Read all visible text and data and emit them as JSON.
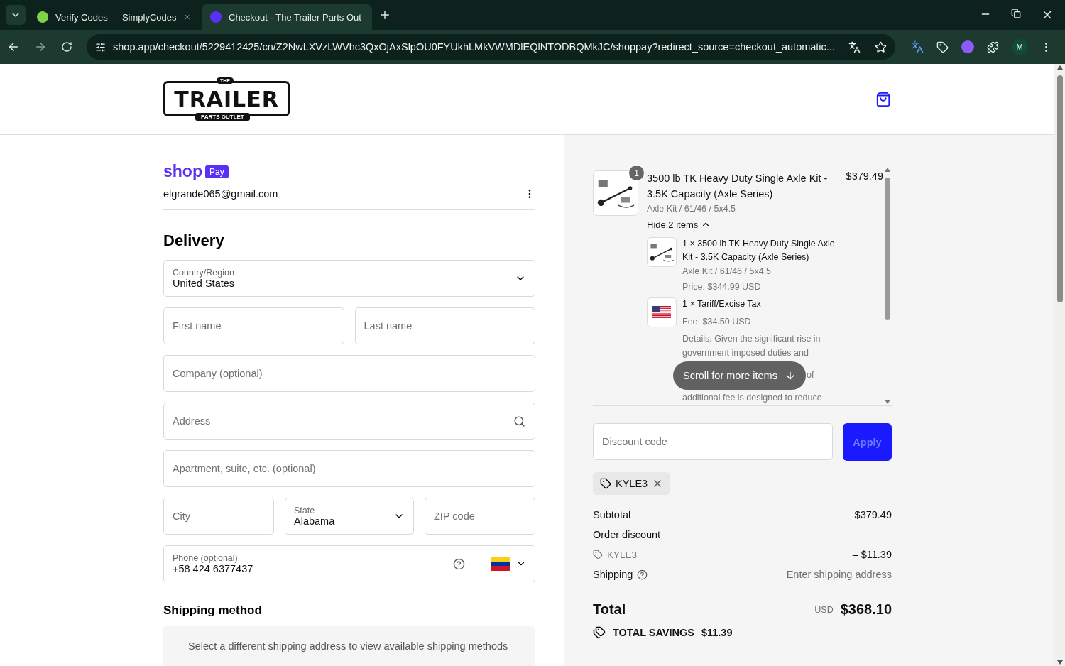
{
  "browser": {
    "tabs": [
      {
        "title": "Verify Codes — SimplyCodes",
        "selected": false
      },
      {
        "title": "Checkout - The Trailer Parts Out",
        "selected": true
      }
    ],
    "url": "shop.app/checkout/5229412425/cn/Z2NwLXVzLWVhc3QxOjAxSlpOU0FYUkhLMkVWMDlEQlNTODBQMkJC/shoppay?redirect_source=checkout_automatic...",
    "profile": "M"
  },
  "header": {
    "logo": {
      "top": "THE",
      "main": "TRAILER",
      "bottom": "PARTS OUTLET"
    }
  },
  "account": {
    "brand": "shop",
    "badge": "Pay",
    "email": "elgrande065@gmail.com"
  },
  "delivery": {
    "title": "Delivery",
    "rows": [
      [
        {
          "kind": "select",
          "label": "Country/Region",
          "value": "United States"
        }
      ],
      [
        {
          "kind": "input",
          "placeholder": "First name"
        },
        {
          "kind": "input",
          "placeholder": "Last name"
        }
      ],
      [
        {
          "kind": "input",
          "placeholder": "Company (optional)"
        }
      ],
      [
        {
          "kind": "search",
          "placeholder": "Address"
        }
      ],
      [
        {
          "kind": "input",
          "placeholder": "Apartment, suite, etc. (optional)"
        }
      ],
      [
        {
          "kind": "input",
          "placeholder": "City"
        },
        {
          "kind": "select",
          "label": "State",
          "value": "Alabama"
        },
        {
          "kind": "input",
          "placeholder": "ZIP code"
        }
      ],
      [
        {
          "kind": "phone",
          "label": "Phone (optional)",
          "value": "+58 424 6377437"
        }
      ]
    ]
  },
  "shipping_method": {
    "title": "Shipping method",
    "message": "Select a different shipping address to view available shipping methods"
  },
  "order": {
    "item": {
      "quantity": "1",
      "name": "3500 lb TK Heavy Duty Single Axle Kit - 3.5K Capacity (Axle Series)",
      "variant": "Axle Kit / 61/46 / 5x4.5",
      "price": "$379.49",
      "toggle": "Hide 2 items",
      "expanded": true
    },
    "sub_items": [
      {
        "kind": "product",
        "line": "1 × 3500 lb TK Heavy Duty Single Axle Kit - 3.5K Capacity (Axle Series)",
        "variant": "Axle Kit / 61/46 / 5x4.5",
        "price": "Price: $344.99 USD"
      },
      {
        "kind": "flag",
        "line": "1 × Tariff/Excise Tax",
        "price": "Fee: $34.50 USD",
        "details": [
          "Details: Given the significant rise in",
          "government imposed duties and",
          "of",
          "additional fee is designed to reduce"
        ]
      }
    ],
    "scroll_hint": "Scroll for more items"
  },
  "discount": {
    "placeholder": "Discount code",
    "button": "Apply",
    "disabled": true,
    "applied": "KYLE3"
  },
  "summary": {
    "subtotal_label": "Subtotal",
    "subtotal": "$379.49",
    "discount_label": "Order discount",
    "discount_code": "KYLE3",
    "discount": "– $11.39",
    "shipping_label": "Shipping",
    "shipping": "Enter shipping address",
    "total_label": "Total",
    "currency": "USD",
    "total": "$368.10",
    "savings_label": "TOTAL SAVINGS",
    "savings": "$11.39"
  }
}
